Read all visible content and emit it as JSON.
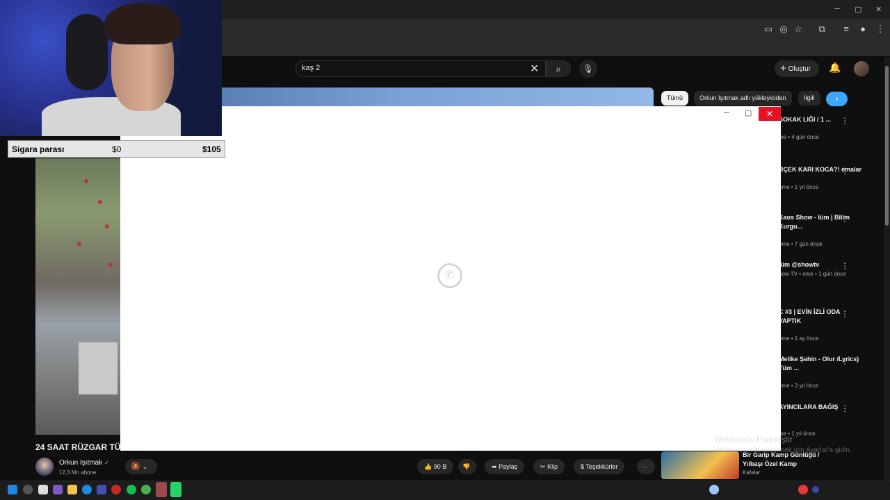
{
  "search": {
    "value": "kaş 2"
  },
  "header": {
    "create_label": "Oluştur"
  },
  "chips": {
    "all": "Tümü",
    "channel": "Orkun Işıtmak adlı yükleyiciden",
    "related": "İlgili"
  },
  "video": {
    "title": "24 SAAT RÜZGAR TÜ",
    "channel": "Orkun Işıtmak",
    "channel_verified": "✓",
    "subscribers": "12,3 Mn abone"
  },
  "actions": {
    "likes": "90 B",
    "share": "Paylaş",
    "clip": "Klip",
    "thanks": "Teşekkürler",
    "more": "⋯"
  },
  "sidebar": {
    "items": [
      {
        "title": "SOKAK LIĞI / 1 ...",
        "meta": "me • 4 gün önce"
      },
      {
        "title": "RÇEK KARI KOCA?! emalar",
        "meta": "eme • 1 yıl önce"
      },
      {
        "title": "Kaos Show - lüm | Bilim Kurgu...",
        "meta": "eme • 7 gün önce"
      },
      {
        "title": "lüm @showtv",
        "meta": "how TV • eme • 1 gün önce"
      },
      {
        "title": "C #3 | EVİN İZLİ ODA YAPTIK",
        "meta": "eme • 1 ay önce"
      },
      {
        "title": "Melike Şahin - Olur /Lyrics) Tüm ...",
        "meta": "eme • 3 yıl önce"
      },
      {
        "title": "AYINCILARA BAĞIŞ",
        "meta": "me • 1 yıl önce"
      },
      {
        "title": "Bir Garip Kamp Günlüğü / Yılbaşı Özel Kamp",
        "meta": "Kafalar"
      }
    ]
  },
  "overlay": {
    "label": "Sigara parası",
    "start": "$0",
    "end": "$105"
  },
  "windows": {
    "activate_title": "Windows'u Etkinleştir",
    "activate_sub": "Windows'u etkinleştirmek için Ayarlar'a gidin."
  },
  "colors": {
    "close_red": "#e81123",
    "chip_blue": "#3ea6ff",
    "bg": "#0f0f0f"
  }
}
